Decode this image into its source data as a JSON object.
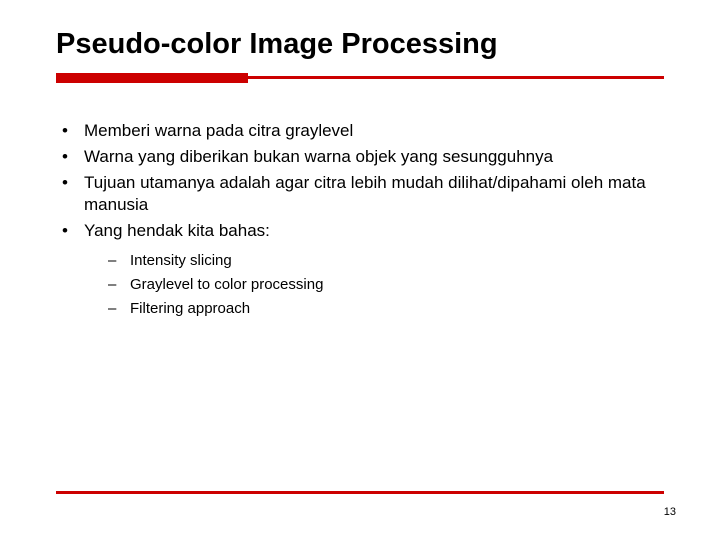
{
  "title": "Pseudo-color Image Processing",
  "bullets": [
    "Memberi warna pada citra graylevel",
    "Warna yang diberikan bukan warna objek yang sesungguhnya",
    "Tujuan utamanya adalah agar citra lebih mudah dilihat/dipahami oleh mata manusia",
    "Yang hendak kita bahas:"
  ],
  "sub_bullets": [
    "Intensity slicing",
    "Graylevel to color processing",
    "Filtering approach"
  ],
  "page_number": "13"
}
